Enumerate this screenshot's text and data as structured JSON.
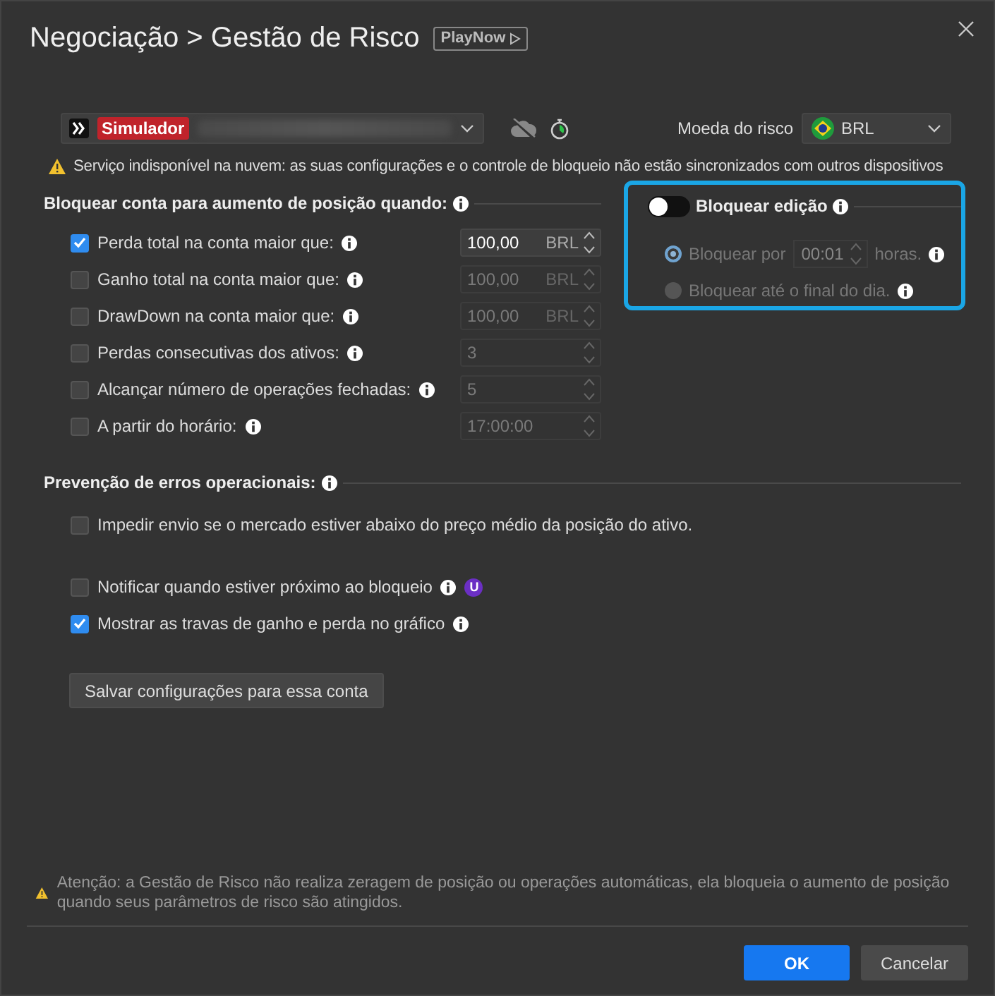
{
  "dialog": {
    "title": "Negociação > Gestão de Risco",
    "badge": "PlayNow"
  },
  "account": {
    "tag": "Simulador"
  },
  "currency": {
    "label": "Moeda do risco",
    "value": "BRL"
  },
  "cloud_warning": "Serviço indisponível na nuvem: as suas configurações e o controle de bloqueio não estão sincronizados com outros dispositivos",
  "block_section": {
    "title": "Bloquear conta para aumento de posição quando:",
    "rules": [
      {
        "label": "Perda total na conta maior que:",
        "checked": true,
        "value": "100,00",
        "unit": "BRL"
      },
      {
        "label": "Ganho total na conta maior que:",
        "checked": false,
        "value": "100,00",
        "unit": "BRL"
      },
      {
        "label": "DrawDown na conta maior que:",
        "checked": false,
        "value": "100,00",
        "unit": "BRL"
      },
      {
        "label": "Perdas consecutivas dos ativos:",
        "checked": false,
        "value": "3"
      },
      {
        "label": "Alcançar número de operações fechadas:",
        "checked": false,
        "value": "5"
      },
      {
        "label": "A partir do horário:",
        "checked": false,
        "value": "17:00:00"
      }
    ]
  },
  "edit_lock": {
    "label": "Bloquear edição",
    "on": false,
    "options": [
      {
        "kind": "duration",
        "label": "Bloquear por",
        "value": "00:01",
        "suffix": "horas.",
        "selected": true
      },
      {
        "kind": "plain",
        "label": "Bloquear até o final do dia.",
        "selected": false
      }
    ]
  },
  "prevention": {
    "title": "Prevenção de erros operacionais:",
    "items": [
      {
        "label": "Impedir envio se o mercado estiver abaixo do preço médio da posição do ativo.",
        "checked": false
      }
    ]
  },
  "extra_options": [
    {
      "label": "Notificar quando estiver próximo ao bloqueio",
      "checked": false,
      "badge": "U"
    },
    {
      "label": "Mostrar as travas de ganho e perda no gráfico",
      "checked": true
    }
  ],
  "save_button": "Salvar configurações para essa conta",
  "notice": "Atenção: a Gestão de Risco não realiza zeragem de posição ou operações automáticas, ela bloqueia o aumento de posição quando seus parâmetros de risco são atingidos.",
  "buttons": [
    {
      "label": "OK",
      "kind": "primary"
    },
    {
      "label": "Cancelar",
      "kind": "secondary"
    }
  ]
}
